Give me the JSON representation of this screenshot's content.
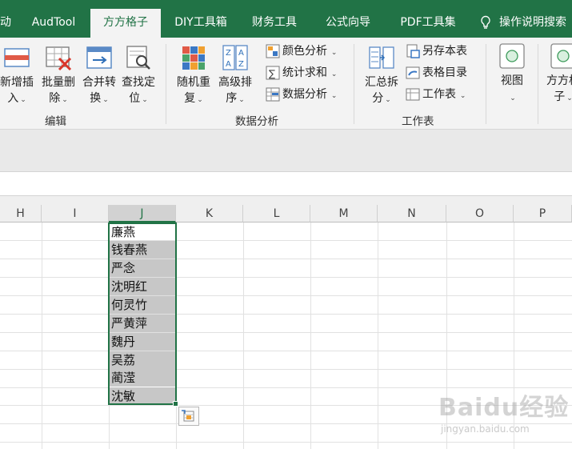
{
  "tabs": [
    {
      "label": "动",
      "active": false
    },
    {
      "label": "AudTool",
      "active": false
    },
    {
      "label": "方方格子",
      "active": true
    },
    {
      "label": "DIY工具箱",
      "active": false
    },
    {
      "label": "财务工具",
      "active": false
    },
    {
      "label": "公式向导",
      "active": false
    },
    {
      "label": "PDF工具集",
      "active": false
    }
  ],
  "help_text": "操作说明搜索",
  "ribbon": {
    "edit_group": {
      "label": "编辑",
      "buttons": [
        {
          "line1": "新增插",
          "line2": "入"
        },
        {
          "line1": "批量删",
          "line2": "除"
        },
        {
          "line1": "合并转",
          "line2": "换"
        },
        {
          "line1": "查找定",
          "line2": "位"
        }
      ]
    },
    "analysis_group": {
      "label": "数据分析",
      "buttons": [
        {
          "line1": "随机重",
          "line2": "复"
        },
        {
          "line1": "高级排",
          "line2": "序"
        }
      ],
      "small_buttons": [
        "颜色分析",
        "统计求和",
        "数据分析"
      ]
    },
    "sheet_group": {
      "label": "工作表",
      "button": {
        "line1": "汇总拆",
        "line2": "分"
      },
      "small_buttons": [
        "另存本表",
        "表格目录",
        "工作表"
      ]
    },
    "view_button": {
      "label": "视图"
    },
    "fangfang_button": {
      "line1": "方方格",
      "line2": "子"
    }
  },
  "columns": [
    "H",
    "I",
    "J",
    "K",
    "L",
    "M",
    "N",
    "O",
    "P"
  ],
  "selected_column": "J",
  "cells": [
    "廉燕",
    "钱春燕",
    "严念",
    "沈明红",
    "何灵竹",
    "严黄萍",
    "魏丹",
    "吴荔",
    "蔺滢",
    "沈敏"
  ],
  "watermark": {
    "main": "Baidu经验",
    "sub": "jingyan.baidu.com"
  },
  "colors": {
    "accent": "#217346",
    "selection_fill": "#c7c7c7"
  }
}
